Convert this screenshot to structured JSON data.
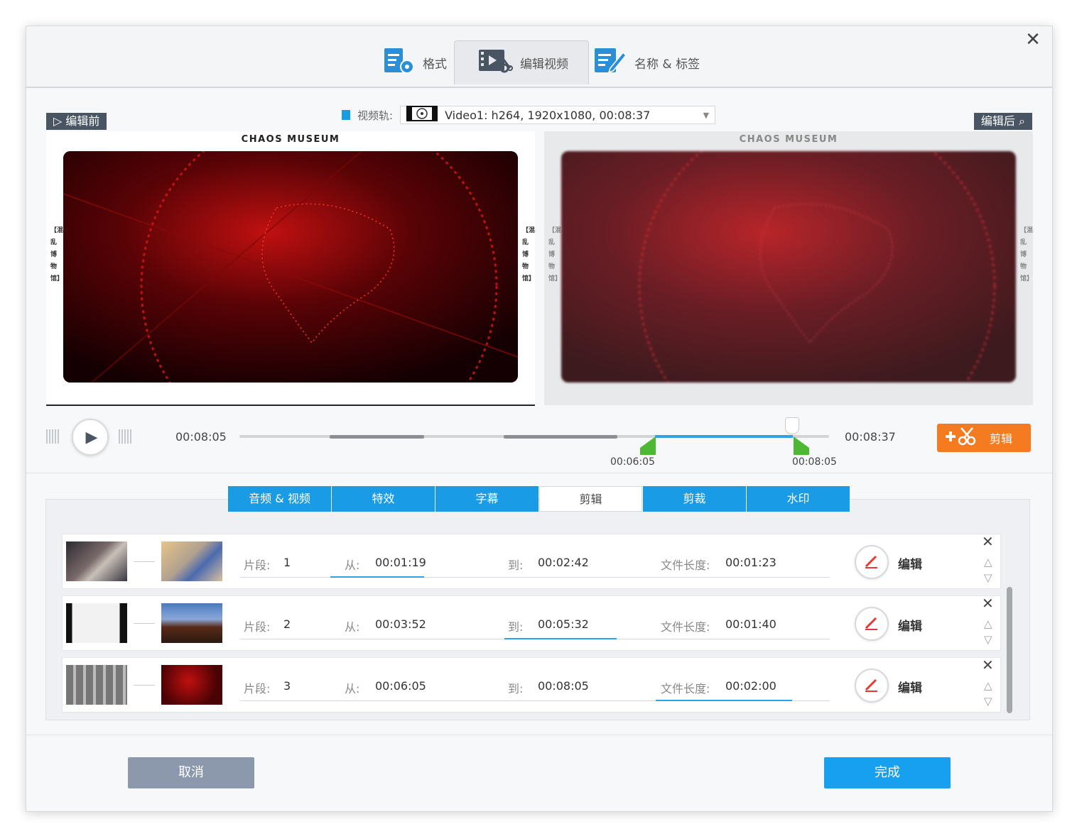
{
  "top_tabs": [
    {
      "label": "格式",
      "icon": "format-settings-icon"
    },
    {
      "label": "编辑视频",
      "icon": "video-edit-icon",
      "active": true
    },
    {
      "label": "名称 & 标签",
      "icon": "name-tag-icon"
    }
  ],
  "preview": {
    "before_label": "编辑前",
    "after_label": "编辑后",
    "track_label": "视频轨:",
    "track_value": "Video1: h264, 1920x1080, 00:08:37",
    "title_text": "CHAOS MUSEUM",
    "side_text": "【混乱博物馆】"
  },
  "player": {
    "current_time": "00:08:05",
    "total_time": "00:08:37",
    "marker_start": "00:06:05",
    "marker_end": "00:08:05",
    "cut_button": "剪辑"
  },
  "edit_tabs": [
    {
      "label": "音频 & 视频"
    },
    {
      "label": "特效"
    },
    {
      "label": "字幕"
    },
    {
      "label": "剪辑",
      "active": true
    },
    {
      "label": "剪裁"
    },
    {
      "label": "水印"
    }
  ],
  "field_labels": {
    "segment": "片段:",
    "from": "从:",
    "to": "到:",
    "length": "文件长度:",
    "edit": "编辑"
  },
  "segments": [
    {
      "index": "1",
      "from": "00:01:19",
      "to": "00:02:42",
      "length": "00:01:23"
    },
    {
      "index": "2",
      "from": "00:03:52",
      "to": "00:05:32",
      "length": "00:01:40"
    },
    {
      "index": "3",
      "from": "00:06:05",
      "to": "00:08:05",
      "length": "00:02:00"
    }
  ],
  "footer": {
    "cancel": "取消",
    "done": "完成"
  },
  "colors": {
    "accent_blue": "#1a9be6",
    "cut_orange": "#f47b20",
    "marker_green": "#4db833"
  }
}
